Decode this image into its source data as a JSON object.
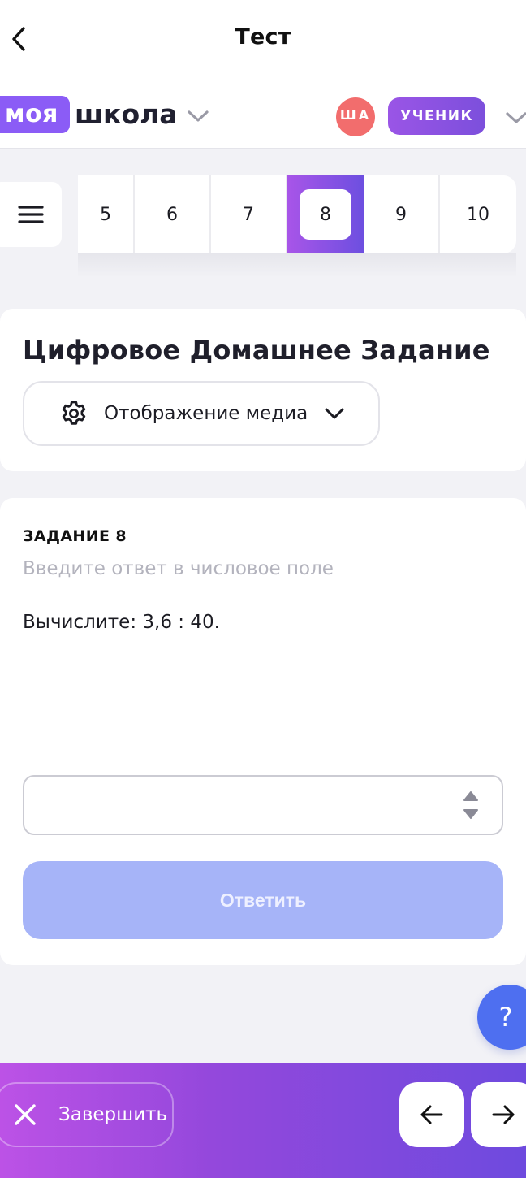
{
  "navbar": {
    "title": "Тест",
    "back_icon": "chevron-left-icon"
  },
  "header": {
    "logo_part1": "моя",
    "logo_part2": "школа",
    "avatar_initials": "ША",
    "role": "УЧЕНИК",
    "colors": {
      "brand": "#8b5cf6",
      "avatar": "#f26d6d"
    }
  },
  "pager": {
    "items": [
      "5",
      "6",
      "7",
      "8",
      "9",
      "10"
    ],
    "active": "8",
    "menu_icon": "hamburger-icon"
  },
  "homework": {
    "title": "Цифровое Домашнее Задание",
    "media_select_label": "Отображение медиа",
    "media_icon": "gear-icon"
  },
  "task": {
    "number_label": "ЗАДАНИЕ 8",
    "hint": "Введите ответ в числовое поле",
    "text": "Вычислите: 3,6 : 40.",
    "answer_value": "",
    "submit_label": "Ответить",
    "submit_color": "#a6b4f8"
  },
  "help": {
    "label": "?"
  },
  "bottom_bar": {
    "finish_label": "Завершить",
    "prev_icon": "arrow-left-icon",
    "next_icon": "arrow-right-icon"
  }
}
